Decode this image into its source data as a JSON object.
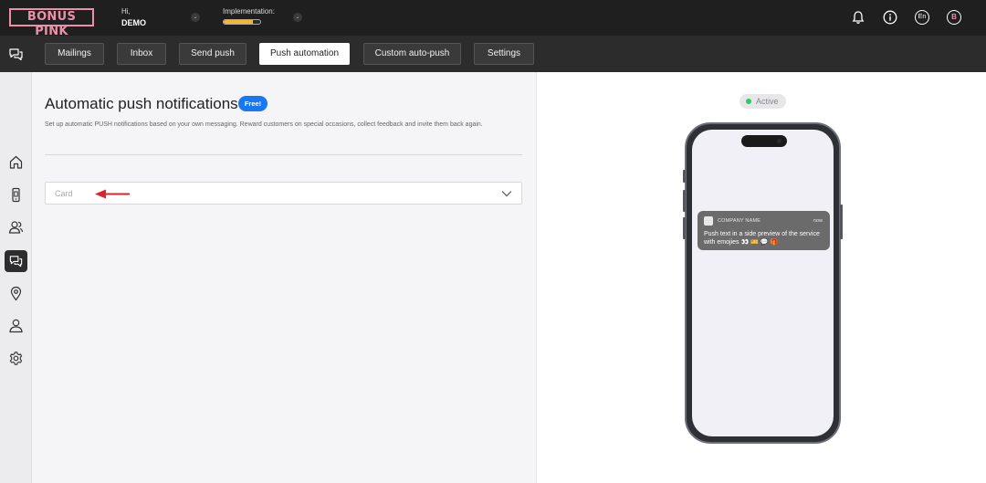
{
  "app": {
    "logo_text": "BONUS PINK"
  },
  "header": {
    "greeting": "Hi,",
    "user_name": "DEMO",
    "implementation_label": "Implementation:",
    "implementation_progress": 0.8,
    "language": "En",
    "avatar_initial": "B"
  },
  "tabs": [
    {
      "label": "Mailings",
      "active": false
    },
    {
      "label": "Inbox",
      "active": false
    },
    {
      "label": "Send push",
      "active": false
    },
    {
      "label": "Push automation",
      "active": true
    },
    {
      "label": "Custom auto-push",
      "active": false
    },
    {
      "label": "Settings",
      "active": false
    }
  ],
  "sidebar": {
    "items": [
      {
        "icon": "home-icon",
        "active": false
      },
      {
        "icon": "phone-card-icon",
        "active": false
      },
      {
        "icon": "users-icon",
        "active": false
      },
      {
        "icon": "chat-icon",
        "active": true
      },
      {
        "icon": "location-pin-icon",
        "active": false
      },
      {
        "icon": "user-icon",
        "active": false
      },
      {
        "icon": "gear-icon",
        "active": false
      }
    ]
  },
  "main": {
    "title": "Automatic push notifications",
    "badge": "Free!",
    "description": "Set up automatic PUSH notifications based on your own messaging. Reward customers on special occasions, collect feedback and invite them back again.",
    "select_value": "Card"
  },
  "preview": {
    "status": "Active",
    "notification": {
      "company": "COMPANY NAME",
      "time": "now",
      "text": "Push text in a side preview of the service with emojies 👀 🎫 💬 🎁"
    }
  },
  "colors": {
    "brand_pink": "#ec8fa8",
    "topbar_bg": "#1f1f1f",
    "tabbar_bg": "#2c2c2c",
    "badge_blue": "#1877f2",
    "status_green": "#2ec866",
    "progress_yellow": "#f2b52b",
    "annotation_red": "#d9262c"
  }
}
